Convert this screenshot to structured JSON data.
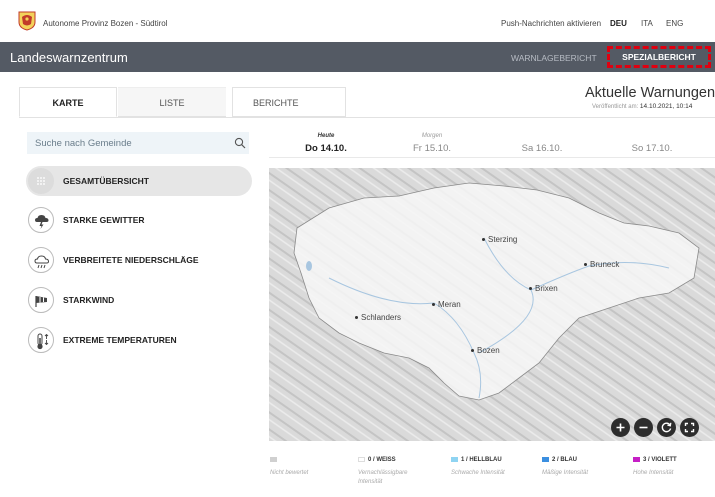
{
  "header": {
    "province_name": "Autonome Provinz Bozen - Südtirol",
    "push_label": "Push-Nachrichten aktivieren",
    "languages": [
      "DEU",
      "ITA",
      "ENG"
    ],
    "active_language": "DEU"
  },
  "titlebar": {
    "app_title": "Landeswarnzentrum",
    "nav_warn": "WARNLAGEBERICHT",
    "nav_special": "SPEZIALBERICHT"
  },
  "tabs": [
    "KARTE",
    "LISTE",
    "BERICHTE"
  ],
  "warnings": {
    "title": "Aktuelle Warnungen",
    "published_label": "Veröffentlicht am:",
    "published_value": "14.10.2021, 10:14"
  },
  "search": {
    "placeholder": "Suche nach Gemeinde"
  },
  "categories": [
    {
      "label": "GESAMTÜBERSICHT",
      "icon": "grid-icon",
      "selected": true
    },
    {
      "label": "STARKE GEWITTER",
      "icon": "thunderstorm-icon",
      "selected": false
    },
    {
      "label": "VERBREITETE NIEDERSCHLÄGE",
      "icon": "rain-cloud-icon",
      "selected": false
    },
    {
      "label": "STARKWIND",
      "icon": "windsock-icon",
      "selected": false
    },
    {
      "label": "EXTREME TEMPERATUREN",
      "icon": "thermometer-icon",
      "selected": false
    }
  ],
  "days": [
    {
      "small": "Heute",
      "big": "Do 14.10.",
      "active": true
    },
    {
      "small": "Morgen",
      "big": "Fr 15.10.",
      "active": false
    },
    {
      "small": "",
      "big": "Sa 16.10.",
      "active": false
    },
    {
      "small": "",
      "big": "So 17.10.",
      "active": false
    }
  ],
  "map": {
    "cities": [
      "Sterzing",
      "Bruneck",
      "Brixen",
      "Meran",
      "Schlanders",
      "Bozen"
    ],
    "controls": [
      "zoom-in-icon",
      "zoom-out-icon",
      "reset-icon",
      "fullscreen-icon"
    ]
  },
  "legend": [
    {
      "title": "",
      "desc": "Nicht bewertet",
      "color": "#d0d0d0"
    },
    {
      "title": "0 / WEISS",
      "desc": "Vernachlässigbare Intensität",
      "color": "#ffffff"
    },
    {
      "title": "1 / HELLBLAU",
      "desc": "Schwache Intensität",
      "color": "#8fd4f2"
    },
    {
      "title": "2 / BLAU",
      "desc": "Mäßige Intensität",
      "color": "#3b8fe0"
    },
    {
      "title": "3 / VIOLETT",
      "desc": "Hohe Intensität",
      "color": "#c61fc6"
    }
  ],
  "colors": {
    "titlebar": "#545a64",
    "highlight": "#e00010"
  }
}
